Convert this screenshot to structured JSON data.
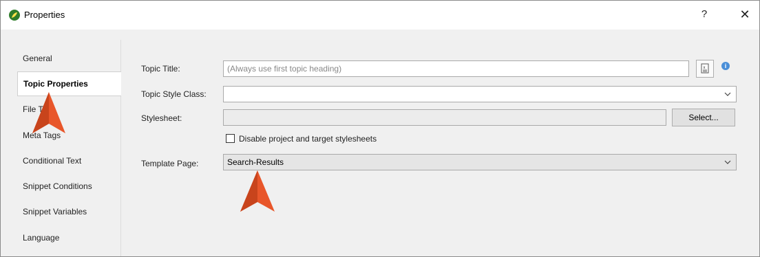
{
  "window": {
    "title": "Properties",
    "help_label": "?",
    "close_label": "✕"
  },
  "sidebar": {
    "items": [
      {
        "label": "General"
      },
      {
        "label": "Topic Properties"
      },
      {
        "label": "File Tags"
      },
      {
        "label": "Meta Tags"
      },
      {
        "label": "Conditional Text"
      },
      {
        "label": "Snippet Conditions"
      },
      {
        "label": "Snippet Variables"
      },
      {
        "label": "Language"
      }
    ],
    "active_index": 1
  },
  "form": {
    "topic_title_label": "Topic Title:",
    "topic_title_placeholder": "(Always use first topic heading)",
    "topic_title_value": "",
    "topic_style_class_label": "Topic Style Class:",
    "topic_style_class_value": "",
    "stylesheet_label": "Stylesheet:",
    "stylesheet_value": "",
    "select_button_label": "Select...",
    "disable_checkbox_label": "Disable project and target stylesheets",
    "disable_checkbox_checked": false,
    "template_page_label": "Template Page:",
    "template_page_value": "Search-Results"
  },
  "colors": {
    "accent_arrow": "#e8562a",
    "info_icon": "#4a8fd8",
    "app_icon": "#3a8d2f"
  }
}
